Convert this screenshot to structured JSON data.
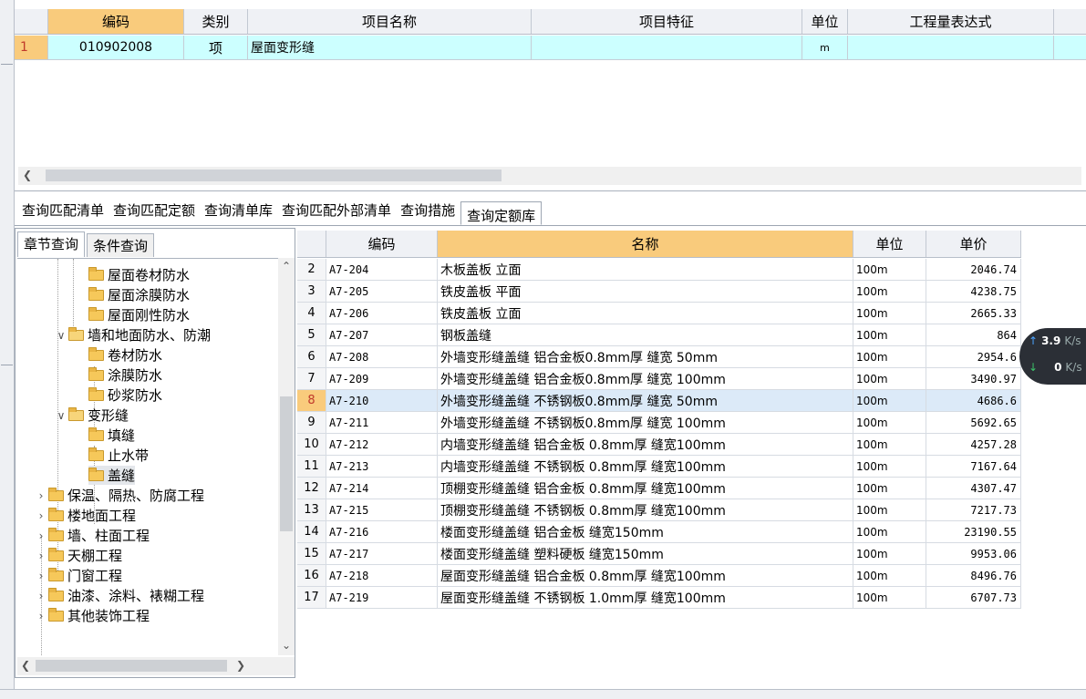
{
  "top_grid": {
    "headers": [
      "编码",
      "类别",
      "项目名称",
      "项目特征",
      "单位",
      "工程量表达式"
    ],
    "row": {
      "num": "1",
      "code": "010902008",
      "type": "项",
      "name": "屋面变形缝",
      "feature": "",
      "unit": "m",
      "expr": ""
    }
  },
  "tabs": [
    "查询匹配清单",
    "查询匹配定额",
    "查询清单库",
    "查询匹配外部清单",
    "查询措施",
    "查询定额库"
  ],
  "left_panel": {
    "subtabs": [
      "章节查询",
      "条件查询"
    ],
    "tree": [
      {
        "label": "屋面卷材防水",
        "level": 3
      },
      {
        "label": "屋面涂膜防水",
        "level": 3
      },
      {
        "label": "屋面刚性防水",
        "level": 3
      },
      {
        "label": "墙和地面防水、防潮",
        "level": 2
      },
      {
        "label": "卷材防水",
        "level": 3
      },
      {
        "label": "涂膜防水",
        "level": 3
      },
      {
        "label": "砂浆防水",
        "level": 3
      },
      {
        "label": "变形缝",
        "level": 2
      },
      {
        "label": "填缝",
        "level": 3
      },
      {
        "label": "止水带",
        "level": 3
      },
      {
        "label": "盖缝",
        "level": 3
      },
      {
        "label": "保温、隔热、防腐工程",
        "level": 1
      },
      {
        "label": "楼地面工程",
        "level": 1
      },
      {
        "label": "墙、柱面工程",
        "level": 1
      },
      {
        "label": "天棚工程",
        "level": 1
      },
      {
        "label": "门窗工程",
        "level": 1
      },
      {
        "label": "油漆、涂料、裱糊工程",
        "level": 1
      },
      {
        "label": "其他装饰工程",
        "level": 1
      }
    ]
  },
  "main_grid": {
    "headers": [
      "",
      "编码",
      "名称",
      "单位",
      "单价"
    ],
    "rows": [
      {
        "num": "2",
        "code": "A7-204",
        "name": "木板盖板 立面",
        "unit": "100m",
        "price": "2046.74"
      },
      {
        "num": "3",
        "code": "A7-205",
        "name": "铁皮盖板 平面",
        "unit": "100m",
        "price": "4238.75"
      },
      {
        "num": "4",
        "code": "A7-206",
        "name": "铁皮盖板 立面",
        "unit": "100m",
        "price": "2665.33"
      },
      {
        "num": "5",
        "code": "A7-207",
        "name": "钢板盖缝",
        "unit": "100m",
        "price": "864"
      },
      {
        "num": "6",
        "code": "A7-208",
        "name": "外墙变形缝盖缝 铝合金板0.8mm厚 缝宽 50mm",
        "unit": "100m",
        "price": "2954.6"
      },
      {
        "num": "7",
        "code": "A7-209",
        "name": "外墙变形缝盖缝 铝合金板0.8mm厚 缝宽 100mm",
        "unit": "100m",
        "price": "3490.97"
      },
      {
        "num": "8",
        "code": "A7-210",
        "name": "外墙变形缝盖缝 不锈钢板0.8mm厚 缝宽 50mm",
        "unit": "100m",
        "price": "4686.6"
      },
      {
        "num": "9",
        "code": "A7-211",
        "name": "外墙变形缝盖缝 不锈钢板0.8mm厚 缝宽 100mm",
        "unit": "100m",
        "price": "5692.65"
      },
      {
        "num": "10",
        "code": "A7-212",
        "name": "内墙变形缝盖缝 铝合金板 0.8mm厚 缝宽100mm",
        "unit": "100m",
        "price": "4257.28"
      },
      {
        "num": "11",
        "code": "A7-213",
        "name": "内墙变形缝盖缝 不锈钢板 0.8mm厚 缝宽100mm",
        "unit": "100m",
        "price": "7167.64"
      },
      {
        "num": "12",
        "code": "A7-214",
        "name": "顶棚变形缝盖缝 铝合金板 0.8mm厚 缝宽100mm",
        "unit": "100m",
        "price": "4307.47"
      },
      {
        "num": "13",
        "code": "A7-215",
        "name": "顶棚变形缝盖缝 不锈钢板 0.8mm厚 缝宽100mm",
        "unit": "100m",
        "price": "7217.73"
      },
      {
        "num": "14",
        "code": "A7-216",
        "name": "楼面变形缝盖缝 铝合金板 缝宽150mm",
        "unit": "100m",
        "price": "23190.55"
      },
      {
        "num": "15",
        "code": "A7-217",
        "name": "楼面变形缝盖缝 塑料硬板 缝宽150mm",
        "unit": "100m",
        "price": "9953.06"
      },
      {
        "num": "16",
        "code": "A7-218",
        "name": "屋面变形缝盖缝 铝合金板 0.8mm厚 缝宽100mm",
        "unit": "100m",
        "price": "8496.76"
      },
      {
        "num": "17",
        "code": "A7-219",
        "name": "屋面变形缝盖缝 不锈钢板 1.0mm厚 缝宽100mm",
        "unit": "100m",
        "price": "6707.73"
      }
    ],
    "selected_num": "8"
  },
  "speed": {
    "up_value": "3.9",
    "up_unit": "K/s",
    "down_value": "0",
    "down_unit": "K/s"
  },
  "colors": {
    "header_selected": "#f9cb7c",
    "row_highlight": "#ccffff",
    "row_selected": "#dceaf8"
  }
}
